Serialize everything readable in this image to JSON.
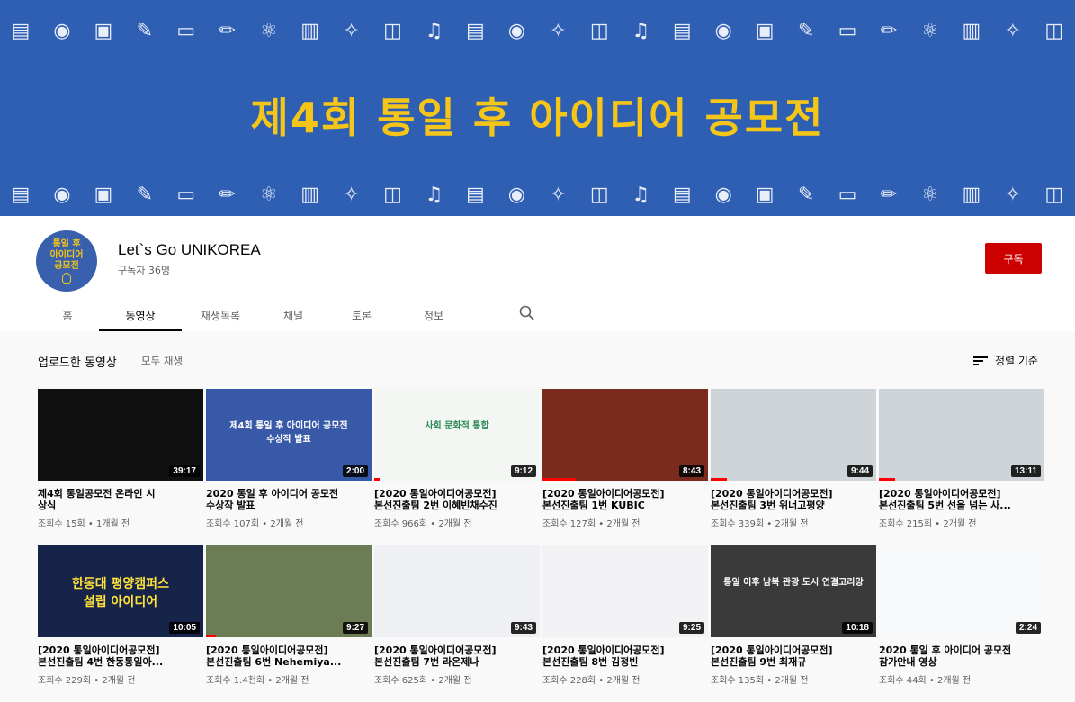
{
  "banner": {
    "title": "제4회 통일 후 아이디어 공모전",
    "icons": [
      "clipboard-icon",
      "globe-icon",
      "clapper-icon",
      "palette-icon",
      "presentation-icon",
      "pencil-icon",
      "atom-icon",
      "document-icon",
      "lightbulb-icon",
      "chart-search-icon",
      "music-icon",
      "clipboard-icon",
      "globe-icon",
      "lightbulb-icon",
      "chart-search-icon",
      "music-icon",
      "clipboard-icon",
      "globe-icon",
      "clapper-icon",
      "palette-icon",
      "presentation-icon",
      "pencil-icon",
      "atom-icon",
      "document-icon",
      "lightbulb-icon",
      "chart-search-icon"
    ],
    "icon_glyphs": [
      "▤",
      "◉",
      "▣",
      "✎",
      "▭",
      "✏",
      "⚛",
      "▥",
      "✧",
      "◫",
      "♫",
      "▤",
      "◉",
      "✧",
      "◫",
      "♫",
      "▤",
      "◉",
      "▣",
      "✎",
      "▭",
      "✏",
      "⚛",
      "▥",
      "✧",
      "◫"
    ],
    "bg_color": "#2f5fb3",
    "title_color": "#f5c518"
  },
  "channel": {
    "avatar_text": [
      "통일 후",
      "아이디어",
      "공모전"
    ],
    "name": "Let`s Go UNIKOREA",
    "subscribers": "구독자 36명",
    "subscribe_label": "구독"
  },
  "tabs": [
    {
      "label": "홈",
      "active": false
    },
    {
      "label": "동영상",
      "active": true
    },
    {
      "label": "재생목록",
      "active": false
    },
    {
      "label": "채널",
      "active": false
    },
    {
      "label": "토론",
      "active": false
    },
    {
      "label": "정보",
      "active": false
    }
  ],
  "section": {
    "title": "업로드한 동영상",
    "play_all": "모두 재생",
    "sort_label": "정렬 기준"
  },
  "videos": [
    {
      "title": "제4회 통일공모전 온라인 시\n상식",
      "views": "조회수 15회",
      "age": "1개월 전",
      "duration": "39:17",
      "theme": "t-dark",
      "progress": 0,
      "thumb_text": ""
    },
    {
      "title": "2020 통일 후 아이디어 공모전\n수상작 발표",
      "views": "조회수 107회",
      "age": "2개월 전",
      "duration": "2:00",
      "theme": "t-blue",
      "progress": 0,
      "thumb_text": "제4회 통일 후 아이디어 공모전\n수상작 발표"
    },
    {
      "title": "[2020 통일아이디어공모전]\n본선진출팀 2번 이혜빈채수진",
      "views": "조회수 966회",
      "age": "2개월 전",
      "duration": "9:12",
      "theme": "t-white",
      "progress": 0.03,
      "thumb_text": "사회 문화적 통합"
    },
    {
      "title": "[2020 통일아이디어공모전]\n본선진출팀 1번 KUBIC",
      "views": "조회수 127회",
      "age": "2개월 전",
      "duration": "8:43",
      "theme": "t-red",
      "progress": 0.2,
      "thumb_text": ""
    },
    {
      "title": "[2020 통일아이디어공모전]\n본선진출팀 3번 위너고평양",
      "views": "조회수 339회",
      "age": "2개월 전",
      "duration": "9:44",
      "theme": "t-gray",
      "progress": 0.1,
      "thumb_text": ""
    },
    {
      "title": "[2020 통일아이디어공모전]\n본선진출팀 5번 선을 넘는 사...",
      "views": "조회수 215회",
      "age": "2개월 전",
      "duration": "13:11",
      "theme": "t-gray",
      "progress": 0.1,
      "thumb_text": ""
    },
    {
      "title": "[2020 통일아이디어공모전]\n본선진출팀 4번 한동통일아...",
      "views": "조회수 229회",
      "age": "2개월 전",
      "duration": "10:05",
      "theme": "t-navy",
      "progress": 0,
      "thumb_text": "한동대 평양캠퍼스\n설립 아이디어"
    },
    {
      "title": "[2020 통일아이디어공모전]\n본선진출팀 6번 Nehemiya...",
      "views": "조회수 1.4천회",
      "age": "2개월 전",
      "duration": "9:27",
      "theme": "t-aerial",
      "progress": 0.06,
      "thumb_text": ""
    },
    {
      "title": "[2020 통일아이디어공모전]\n본선진출팀 7번 라온제나",
      "views": "조회수 625회",
      "age": "2개월 전",
      "duration": "9:43",
      "theme": "t-slide",
      "progress": 0,
      "thumb_text": ""
    },
    {
      "title": "[2020 통일아이디어공모전]\n본선진출팀 8번 김정빈",
      "views": "조회수 228회",
      "age": "2개월 전",
      "duration": "9:25",
      "theme": "t-chart",
      "progress": 0,
      "thumb_text": ""
    },
    {
      "title": "[2020 통일아이디어공모전]\n본선진출팀 9번 최재규",
      "views": "조회수 135회",
      "age": "2개월 전",
      "duration": "10:18",
      "theme": "t-darkgray",
      "progress": 0,
      "thumb_text": "통일 이후 남북 관광 도시 연결고리망"
    },
    {
      "title": "2020 통일 후 아이디어 공모전\n참가안내 영상",
      "views": "조회수 44회",
      "age": "2개월 전",
      "duration": "2:24",
      "theme": "t-lightslide",
      "progress": 0,
      "thumb_text": ""
    }
  ]
}
